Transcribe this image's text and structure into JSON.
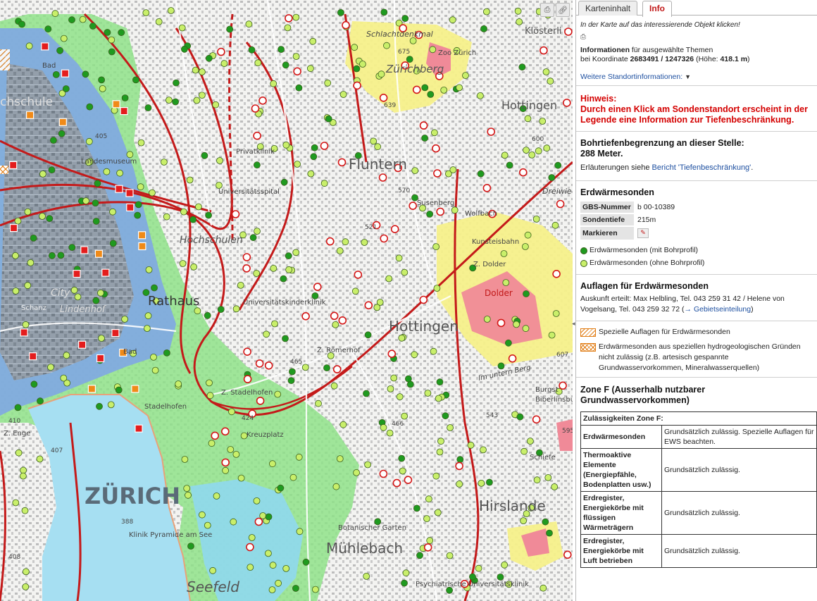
{
  "map": {
    "labels": {
      "schlachtdenkmal": "Schlachtdenkmal",
      "zoo_zuerich": "Zoo Zürich",
      "zuerichberg": "Zürichberg",
      "kloesterli": "Klösterli",
      "hottingen_n": "Hottingen",
      "fluntern": "Fluntern",
      "privatklinik": "Privatklinik",
      "universitaetsspital": "Universitätsspital",
      "landesmuseum": "Landesmuseum",
      "hochschulen": "Hochschulen",
      "susenberg": "Susenberg",
      "wolfbach": "Wolfbach",
      "dreiwiesen": "Dreiwie",
      "kunsteisbahn": "Kunsteisbahn",
      "z_dolder": "Z. Dolder",
      "dolder": "Dolder",
      "city": "City",
      "lindenhof": "Lindenhof",
      "rathaus": "Rathaus",
      "unikinderklinik": "Universitätskinderklinik",
      "z_roemerhof": "Z. Römerhof",
      "hottingen": "Hottingen",
      "im_untern_berg": "Im untern Berg",
      "burgstrasse": "Burgst",
      "biberlinsburg": "Biberlinsburg",
      "z_stadelhofen": "Z. Stadelhofen",
      "stadelhofen": "Stadelhofen",
      "kreuzplatz": "Kreuzplatz",
      "zuerich": "ZÜRICH",
      "klinik_pyramide": "Klinik Pyramide am See",
      "botanischer_garten": "Botanischer Garten",
      "muehlebach": "Mühlebach",
      "seefeld": "Seefeld",
      "hirslanden": "Hirslande",
      "schieferstr": "Schiefe",
      "psychiatrische": "Psychiatrische Universitätsklinik",
      "schanzengraben": "Schanz",
      "hochschule_zh": "chschule",
      "bad1": "Bad",
      "bad2": "Bad",
      "z_enge": "Z. Enge",
      "alt_675": "675",
      "alt_639": "639",
      "alt_600": "600",
      "alt_570": "570",
      "alt_521": "521",
      "alt_465": "465",
      "alt_466": "466",
      "alt_424": "424",
      "alt_410": "410",
      "alt_407": "407",
      "alt_388": "388",
      "alt_408": "408",
      "alt_405": "405",
      "alt_607": "607",
      "alt_543": "543",
      "alt_595": "595"
    },
    "tools": {
      "print_icon": "printer-icon",
      "link_icon": "link-icon"
    }
  },
  "panel": {
    "tabs": {
      "map_content": "Karteninhalt",
      "info": "Info"
    },
    "instruction": "In der Karte auf das interessierende Objekt klicken!",
    "info_heading_bold": "Informationen",
    "info_heading_rest": " für ausgewählte Themen",
    "coord_prefix": "bei Koordinate ",
    "coord_value": "2683491 / 1247326",
    "height_prefix": " (Höhe: ",
    "height_value": "418.1 m",
    "height_suffix": ")",
    "more_location": "Weitere Standortinformationen:",
    "hint_title": "Hinweis:",
    "hint_text": "Durch einen Klick am Sondenstandort erscheint in der Legende eine Information zur Tiefenbeschränkung.",
    "depth_title": "Bohrtiefenbegrenzung an dieser Stelle:",
    "depth_value": "288 Meter.",
    "explain_prefix": "Erläuterungen siehe ",
    "explain_link": "Bericht 'Tiefenbeschränkung'",
    "explain_suffix": ".",
    "ews_title": "Erdwärmesonden",
    "ews_rows": [
      {
        "key": "GBS-Nummer",
        "value": "b 00-10389"
      },
      {
        "key": "Sondentiefe",
        "value": "215m"
      },
      {
        "key": "Markieren",
        "value": ""
      }
    ],
    "legend_with_profile": "Erdwärmesonden (mit Bohrprofil)",
    "legend_without_profile": "Erdwärmesonden (ohne Bohrprofil)",
    "auflagen_title": "Auflagen für Erdwärmesonden",
    "auflagen_text": "Auskunft erteilt: Max Helbling, Tel. 043 259 31 42 / Helene von Vogelsang, Tel. 043 259 32 72 (",
    "auflagen_arrow": "→",
    "auflagen_link": "Gebietseinteilung",
    "auflagen_close": ")",
    "legend_special": "Spezielle Auflagen für Erdwärmesonden",
    "legend_forbidden": "Erdwärmesonden aus speziellen hydrogeologischen Gründen nicht zulässig (z.B. artesisch gespannte Grundwasservorkommen, Mineralwasserquellen)",
    "zone_title": "Zone F (Ausserhalb nutzbarer Grundwasservorkommen)",
    "zone_table_head": "Zulässigkeiten Zone F:",
    "zone_rows": [
      {
        "k": "Erdwärmesonden",
        "v": "Grundsätzlich zulässig. Spezielle Auflagen für EWS beachten."
      },
      {
        "k": "Thermoaktive Elemente (Energiepfähle, Bodenplatten usw.)",
        "v": "Grundsätzlich zulässig."
      },
      {
        "k": "Erdregister, Energiekörbe mit flüssigen Wärmeträgern",
        "v": "Grundsätzlich zulässig."
      },
      {
        "k": "Erdregister, Energiekörbe mit Luft betrieben",
        "v": "Grundsätzlich zulässig."
      }
    ]
  },
  "colors": {
    "green_dot": "#1f9a1f",
    "lightgreen_dot": "#c9ef6a",
    "red_line": "#c41a1a",
    "blue_zone": "#7fa7e3",
    "cyan_zone": "#8fd8ee",
    "green_zone": "#8fe28a",
    "yellow_zone": "#f6f08a",
    "pink_zone": "#f08a98"
  }
}
